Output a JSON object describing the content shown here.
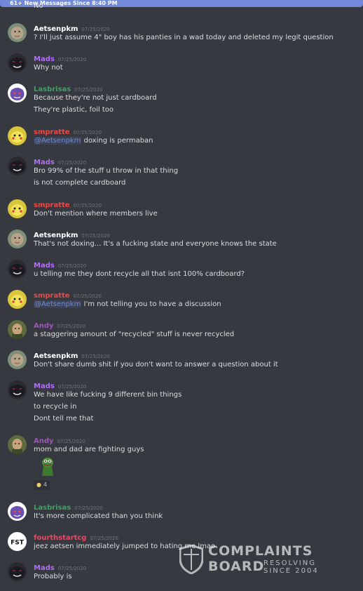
{
  "new_messages_bar": "61+ New Messages Since 8:40 PM",
  "cut_off_text": "No",
  "colors": {
    "Aetsenpkm": "#ffffff",
    "Mads": "#b36ef5",
    "Lasbrisas": "#3aa55c",
    "smpratte": "#f04747",
    "Andy": "#9b59b6",
    "fourthstartcg": "#e44b65",
    "mention": "#7289da"
  },
  "messages": [
    {
      "author": "Aetsenpkm",
      "time": "07/25/2020",
      "lines": [
        "? I'll just assume 4\" boy has his panties in a wad today and deleted my legit question"
      ]
    },
    {
      "author": "Mads",
      "time": "07/25/2020",
      "lines": [
        "Why not"
      ]
    },
    {
      "author": "Lasbrisas",
      "time": "07/25/2020",
      "lines": [
        "Because they're not just cardboard",
        "They're plastic, foil too"
      ]
    },
    {
      "author": "smpratte",
      "time": "07/25/2020",
      "mention": "@Aetsenpkm",
      "lines": [
        " doxing is permaban"
      ]
    },
    {
      "author": "Mads",
      "time": "07/25/2020",
      "lines": [
        "Bro 99% of the stuff u throw in that thing",
        "is not complete cardboard"
      ]
    },
    {
      "author": "smpratte",
      "time": "07/25/2020",
      "lines": [
        "Don't mention where members live"
      ]
    },
    {
      "author": "Aetsenpkm",
      "time": "07/25/2020",
      "lines": [
        "That's not doxing... It's a fucking state and everyone knows the state"
      ]
    },
    {
      "author": "Mads",
      "time": "07/25/2020",
      "lines": [
        "u telling me they dont recycle all that isnt 100% cardboard?"
      ]
    },
    {
      "author": "smpratte",
      "time": "07/25/2020",
      "mention": "@Aetsenpkm",
      "lines": [
        " I'm not telling you to have a discussion"
      ]
    },
    {
      "author": "Andy",
      "time": "07/25/2020",
      "lines": [
        "a staggering amount of \"recycled\" stuff is never recycled"
      ]
    },
    {
      "author": "Aetsenpkm",
      "time": "07/25/2020",
      "lines": [
        "Don't share dumb shit if you don't want to answer a question about it"
      ]
    },
    {
      "author": "Mads",
      "time": "07/25/2020",
      "lines": [
        "We have like fucking 9 different bin things",
        "to recycle in",
        "Dont tell me that"
      ]
    },
    {
      "author": "Andy",
      "time": "07/25/2020",
      "lines": [
        "mom and dad are fighting guys"
      ],
      "reaction_count": "4"
    },
    {
      "author": "Lasbrisas",
      "time": "07/25/2020",
      "lines": [
        "It's more complicated than you think"
      ]
    },
    {
      "author": "fourthstartcg",
      "time": "07/25/2020",
      "lines": [
        "jeez aetsen immediately jumped to hating me lmao"
      ]
    },
    {
      "author": "Mads",
      "time": "07/25/2020",
      "lines": [
        "Probably is"
      ]
    }
  ],
  "watermark": {
    "line1": "COMPLAINTS",
    "line2": "BOARD",
    "tag1": "RESOLVING",
    "tag2": "SINCE 2004"
  }
}
